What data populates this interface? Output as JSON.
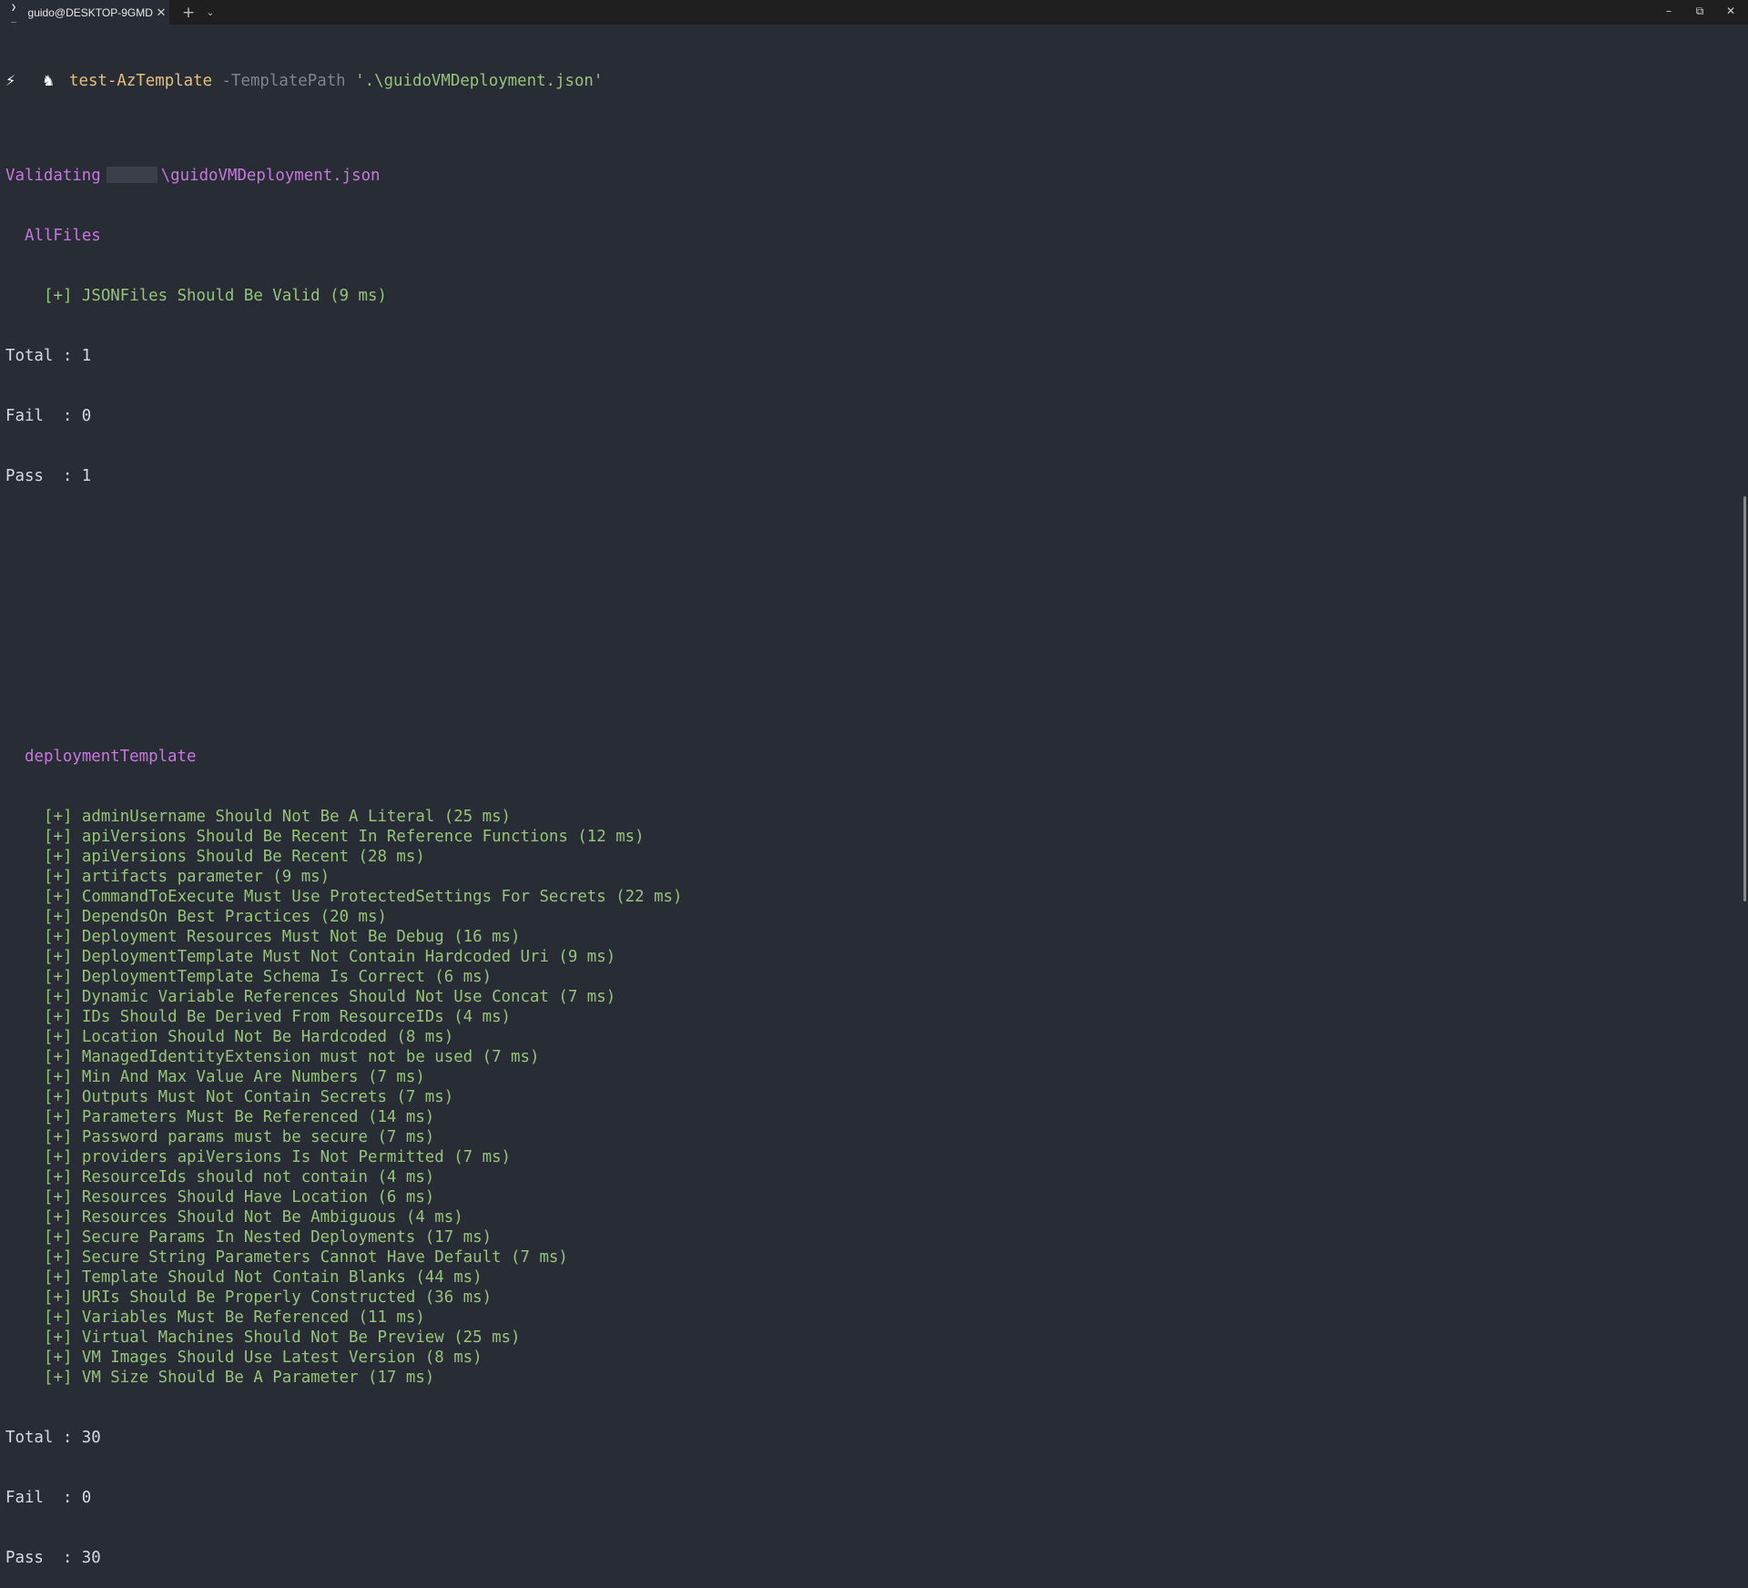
{
  "window": {
    "tab_icon": "❯_",
    "tab_title": "guido@DESKTOP-9GMD",
    "tab_close": "✕",
    "new_tab": "+",
    "dropdown": "⌵",
    "minimize": "–",
    "restore": "⧉",
    "close": "✕"
  },
  "prompt": {
    "bolt_icon": "⚡",
    "user_icon": "♞",
    "command": "test-AzTemplate",
    "param": "-TemplatePath",
    "value": "'.\\guidoVMDeployment.json'"
  },
  "validating": {
    "label": "Validating",
    "path": "\\guidoVMDeployment.json"
  },
  "allfiles": {
    "group": "AllFiles",
    "tests": [
      "[+] JSONFiles Should Be Valid (9 ms)"
    ],
    "total": "Total : 1",
    "fail": "Fail  : 0",
    "pass": "Pass  : 1"
  },
  "deployment": {
    "group": "deploymentTemplate",
    "tests": [
      "[+] adminUsername Should Not Be A Literal (25 ms)",
      "[+] apiVersions Should Be Recent In Reference Functions (12 ms)",
      "[+] apiVersions Should Be Recent (28 ms)",
      "[+] artifacts parameter (9 ms)",
      "[+] CommandToExecute Must Use ProtectedSettings For Secrets (22 ms)",
      "[+] DependsOn Best Practices (20 ms)",
      "[+] Deployment Resources Must Not Be Debug (16 ms)",
      "[+] DeploymentTemplate Must Not Contain Hardcoded Uri (9 ms)",
      "[+] DeploymentTemplate Schema Is Correct (6 ms)",
      "[+] Dynamic Variable References Should Not Use Concat (7 ms)",
      "[+] IDs Should Be Derived From ResourceIDs (4 ms)",
      "[+] Location Should Not Be Hardcoded (8 ms)",
      "[+] ManagedIdentityExtension must not be used (7 ms)",
      "[+] Min And Max Value Are Numbers (7 ms)",
      "[+] Outputs Must Not Contain Secrets (7 ms)",
      "[+] Parameters Must Be Referenced (14 ms)",
      "[+] Password params must be secure (7 ms)",
      "[+] providers apiVersions Is Not Permitted (7 ms)",
      "[+] ResourceIds should not contain (4 ms)",
      "[+] Resources Should Have Location (6 ms)",
      "[+] Resources Should Not Be Ambiguous (4 ms)",
      "[+] Secure Params In Nested Deployments (17 ms)",
      "[+] Secure String Parameters Cannot Have Default (7 ms)",
      "[+] Template Should Not Contain Blanks (44 ms)",
      "[+] URIs Should Be Properly Constructed (36 ms)",
      "[+] Variables Must Be Referenced (11 ms)",
      "[+] Virtual Machines Should Not Be Preview (25 ms)",
      "[+] VM Images Should Use Latest Version (8 ms)",
      "[+] VM Size Should Be A Parameter (17 ms)"
    ],
    "total": "Total : 30",
    "fail": "Fail  : 0",
    "pass": "Pass  : 30"
  }
}
